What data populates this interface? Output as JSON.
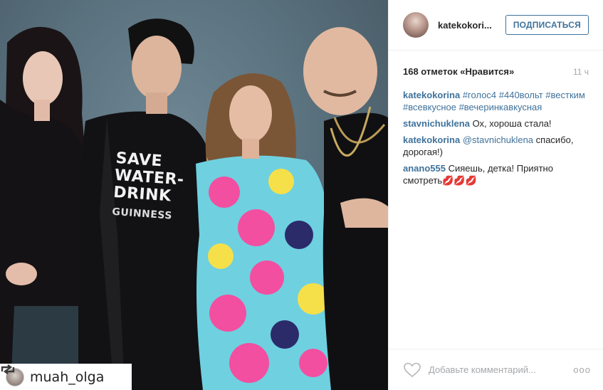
{
  "photo": {
    "tshirt_lines": [
      "SAVE",
      "WATER-",
      "DRINK"
    ],
    "tshirt_small": "GUINNESS"
  },
  "repost": {
    "icon": "repost-icon",
    "username": "muah_olga"
  },
  "post": {
    "author": "katekokori...",
    "follow_label": "ПОДПИСАТЬСЯ",
    "likes": "168 отметок «Нравится»",
    "time": "11 ч",
    "caption": {
      "user": "katekokorina",
      "tags": "#голос4 #440вольт #вестким #всевкусное #вечеринкавкусная"
    },
    "comments": [
      {
        "user": "stavnichuklena",
        "text": "Ох, хороша стала!"
      },
      {
        "user": "katekokorina",
        "mention": "@stavnichuklena",
        "text": "спасибо, дорогая!)"
      },
      {
        "user": "anano555",
        "text": "Сияешь, детка! Приятно смотреть💋💋💋"
      }
    ],
    "add_comment_placeholder": "Добавьте комментарий...",
    "more_label": "ooo"
  },
  "colors": {
    "link": "#3f729b",
    "muted": "#a5a7aa",
    "text": "#262626"
  }
}
